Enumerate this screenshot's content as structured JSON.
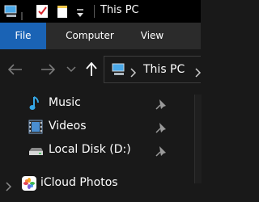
{
  "window": {
    "title": "This PC"
  },
  "ribbon": {
    "tabs": [
      {
        "label": "File",
        "active": true
      },
      {
        "label": "Computer",
        "active": false
      },
      {
        "label": "View",
        "active": false
      }
    ]
  },
  "address": {
    "path": "This PC"
  },
  "quick_access": [
    {
      "label": "Music",
      "icon": "music-icon",
      "pinned": true
    },
    {
      "label": "Videos",
      "icon": "videos-icon",
      "pinned": true
    },
    {
      "label": "Local Disk (D:)",
      "icon": "drive-icon",
      "pinned": true
    }
  ],
  "tree": [
    {
      "label": "iCloud Photos",
      "icon": "icloud-photos-icon",
      "expanded": false
    }
  ],
  "colors": {
    "accent": "#1a63b5",
    "background": "#191919",
    "titlebar": "#000000",
    "ribbon": "#2b2b2b"
  }
}
